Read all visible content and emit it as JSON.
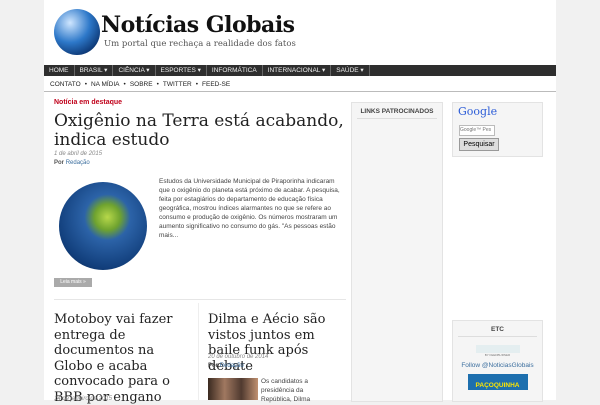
{
  "site": {
    "name": "Notícias Globais",
    "tagline": "Um portal que rechaça a realidade dos fatos"
  },
  "nav": [
    "HOME",
    "BRASIL ▾",
    "CIÊNCIA ▾",
    "ESPORTES ▾",
    "INFORMÁTICA",
    "INTERNACIONAL ▾",
    "SAÚDE ▾"
  ],
  "subnav": [
    "CONTATO",
    "•",
    "NA MÍDIA",
    "•",
    "SOBRE",
    "•",
    "TWITTER",
    "•",
    "FEED-SE"
  ],
  "featured": {
    "label": "Notícia em destaque",
    "title": "Oxigênio na Terra está acabando, indica estudo",
    "date": "1 de abril de 2015",
    "by": "Por",
    "author": "Redação",
    "excerpt": "Estudos da Universidade Municipal de Piraporinha indicaram que o oxigênio do planeta está próximo de acabar. A pesquisa, feita por estagiários do departamento de educação física geográfica, mostrou índices alarmantes no que se refere ao consumo e produção de oxigênio. Os números mostraram um aumento significativo no consumo do gás. \"As pessoas estão mais...",
    "more": "Leia mais »"
  },
  "posts": [
    {
      "title": "Motoboy vai fazer entrega de documentos na Globo e acaba convocado para o BBB por engano",
      "date": "14 de janeiro de 2015"
    },
    {
      "title": "Dilma e Aécio são vistos juntos em baile funk após debate",
      "date": "20 de outubro de 2014",
      "by": "Por",
      "author": "Redação",
      "excerpt": "Os candidatos a presidência da República, Dilma"
    }
  ],
  "sidebar": {
    "sponsored": "LINKS PATROCINADOS",
    "google": "Google",
    "search_placeholder": "Google™ Pes",
    "search_button": "Pesquisar",
    "etc": "ETC",
    "feedburner": "BY FEEDBURNER",
    "follow": "Follow @NoticiasGlobais",
    "banner": "PAÇOQUINHA"
  }
}
